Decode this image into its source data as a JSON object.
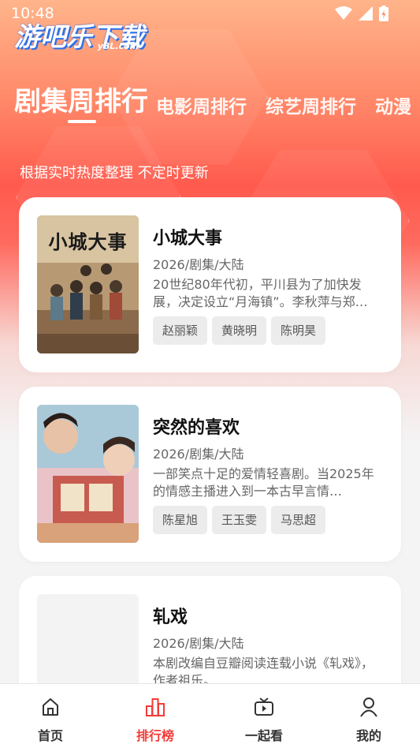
{
  "status_bar": {
    "time": "10:48"
  },
  "logo": {
    "main": "游吧乐下载",
    "sub": "yBL.com"
  },
  "tabs": [
    {
      "label": "剧集周排行",
      "active": true
    },
    {
      "label": "电影周排行",
      "active": false
    },
    {
      "label": "综艺周排行",
      "active": false
    },
    {
      "label": "动漫",
      "active": false
    }
  ],
  "subtitle": "根据实时热度整理 不定时更新",
  "cards": [
    {
      "title": "小城大事",
      "meta": "2026/剧集/大陆",
      "desc": "20世纪80年代初，平川县为了加快发展，决定设立“月海镇”。李秋萍与郑…",
      "tags": [
        "赵丽颖",
        "黄晓明",
        "陈明昊"
      ],
      "poster_text": "小城大事"
    },
    {
      "title": "突然的喜欢",
      "meta": "2026/剧集/大陆",
      "desc": "一部笑点十足的爱情轻喜剧。当2025年的情感主播进入到一本古早言情…",
      "tags": [
        "陈星旭",
        "王玉雯",
        "马思超"
      ],
      "poster_text": ""
    },
    {
      "title": "轧戏",
      "meta": "2026/剧集/大陆",
      "desc": "本剧改编自豆瓣阅读连载小说《轧戏》，作者祖乐。",
      "tags": [],
      "poster_text": ""
    }
  ],
  "bottom_nav": [
    {
      "label": "首页",
      "icon": "home-icon",
      "active": false
    },
    {
      "label": "排行榜",
      "icon": "ranking-icon",
      "active": true
    },
    {
      "label": "一起看",
      "icon": "tv-icon",
      "active": false
    },
    {
      "label": "我的",
      "icon": "user-icon",
      "active": false
    }
  ],
  "colors": {
    "accent": "#f43a37",
    "hero_top": "#ffb48a",
    "hero_mid": "#ff5a4d"
  }
}
